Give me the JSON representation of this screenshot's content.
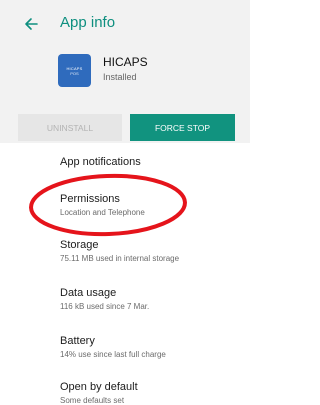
{
  "header": {
    "title": "App info",
    "back_icon": "arrow-left-icon",
    "accent_color": "#0e8f7f"
  },
  "app": {
    "icon_text": "HICAPS",
    "icon_subtext": "POS",
    "name": "HICAPS",
    "status": "Installed"
  },
  "actions": {
    "uninstall_label": "UNINSTALL",
    "force_stop_label": "FORCE STOP",
    "force_stop_color": "#11937f"
  },
  "settings": [
    {
      "title": "App notifications",
      "subtitle": ""
    },
    {
      "title": "Permissions",
      "subtitle": "Location and Telephone"
    },
    {
      "title": "Storage",
      "subtitle": "75.11 MB used in internal storage"
    },
    {
      "title": "Data usage",
      "subtitle": "116 kB used since 7 Mar."
    },
    {
      "title": "Battery",
      "subtitle": "14% use since last full charge"
    },
    {
      "title": "Open by default",
      "subtitle": "Some defaults set"
    }
  ],
  "annotation": {
    "shape": "ellipse",
    "color": "#e5141b",
    "target": "Permissions"
  }
}
